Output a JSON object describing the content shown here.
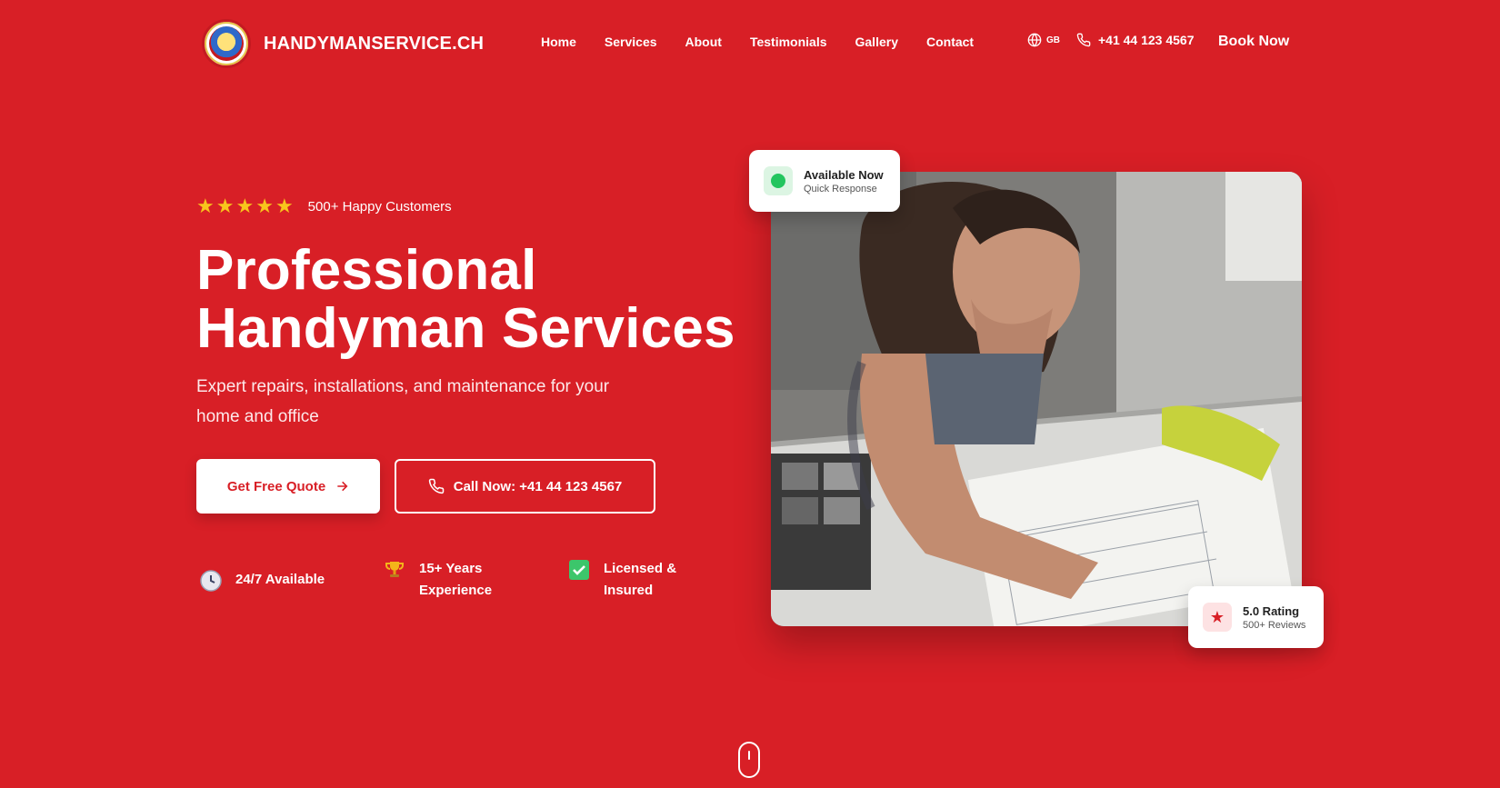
{
  "nav": {
    "brand": "HANDYMANSERVICE.CH",
    "links": [
      "Home",
      "Services",
      "About",
      "Testimonials",
      "Gallery",
      "Contact"
    ],
    "lang": "GB",
    "phone": "+41 44 123 4567",
    "book": "Book Now"
  },
  "hero": {
    "rating_stars": 5,
    "customers": "500+ Happy Customers",
    "title_line1": "Professional",
    "title_line2": "Handyman Services",
    "subtitle": "Expert repairs, installations, and maintenance for your home and office",
    "primary_cta": "Get Free Quote",
    "secondary_cta": "Call Now: +41 44 123 4567",
    "features": [
      {
        "icon": "clock-icon",
        "label": "24/7 Available"
      },
      {
        "icon": "trophy-icon",
        "label": "15+ Years Experience"
      },
      {
        "icon": "checkbox-icon",
        "label": "Licensed & Insured"
      }
    ]
  },
  "badges": {
    "available_title": "Available Now",
    "available_sub": "Quick Response",
    "rating_title": "5.0 Rating",
    "rating_sub": "500+ Reviews"
  },
  "colors": {
    "brand_red": "#d81f26",
    "star_yellow": "#f8c51c",
    "status_green": "#22c55e"
  }
}
